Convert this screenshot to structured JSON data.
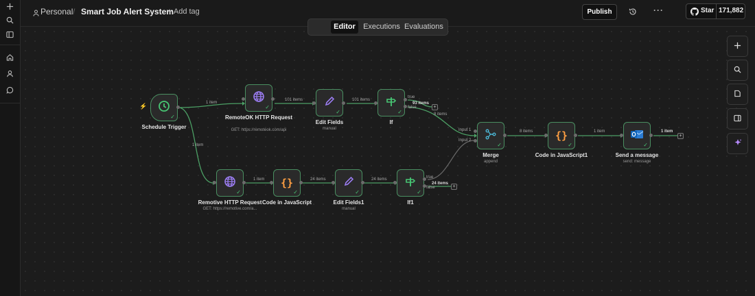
{
  "breadcrumb": {
    "workspace": "Personal",
    "separator": "/",
    "workflow_name": "Smart Job Alert System",
    "add_tag": "+ Add tag"
  },
  "header": {
    "publish": "Publish",
    "star": "Star",
    "star_count": "171,882"
  },
  "tabs": [
    {
      "label": "Editor",
      "active": true
    },
    {
      "label": "Executions",
      "active": false
    },
    {
      "label": "Evaluations",
      "active": false
    }
  ],
  "nodes": {
    "schedule": {
      "name": "Schedule Trigger",
      "icon": "clock-icon"
    },
    "remoteok": {
      "name": "RemoteOK HTTP Request",
      "sub": "GET: https://remoteok.com/api",
      "icon": "globe-icon"
    },
    "editfields": {
      "name": "Edit Fields",
      "sub": "manual",
      "icon": "pencil-icon"
    },
    "if": {
      "name": "If",
      "icon": "signpost-icon"
    },
    "merge": {
      "name": "Merge",
      "sub": "append",
      "icon": "merge-icon"
    },
    "code1": {
      "name": "Code in JavaScript1",
      "icon": "braces-icon"
    },
    "send": {
      "name": "Send a message",
      "sub": "send: message",
      "icon": "outlook-icon"
    },
    "remotive": {
      "name": "Remotive HTTP Request",
      "sub": "GET: https://remotive.com/a...",
      "icon": "globe-icon"
    },
    "code": {
      "name": "Code in JavaScript",
      "icon": "braces-icon"
    },
    "editfields1": {
      "name": "Edit Fields1",
      "sub": "manual",
      "icon": "pencil-icon"
    },
    "if1": {
      "name": "If1",
      "icon": "signpost-icon"
    }
  },
  "edges": {
    "sched_remoteok": "1 item",
    "sched_remotive": "1 item",
    "remoteok_edit": "101 items",
    "edit_if": "101 items",
    "if_true": "true",
    "if_false": "false",
    "if_count": "93 items",
    "if_merge": "8 items",
    "merge_in1": "Input 1",
    "merge_in2": "Input 2",
    "merge_code1": "8 items",
    "code1_send": "1 item",
    "send_out": "1 item",
    "remotive_code": "1 item",
    "code_edit1": "24 items",
    "edit1_if1": "24 items",
    "if1_true": "true",
    "if1_false": "false",
    "if1_count": "24 items"
  },
  "colors": {
    "edge": "#4ca065",
    "edge_gray": "#6a6a6a",
    "node_border": "#4a8f61",
    "accent": "#ff6d5a"
  }
}
